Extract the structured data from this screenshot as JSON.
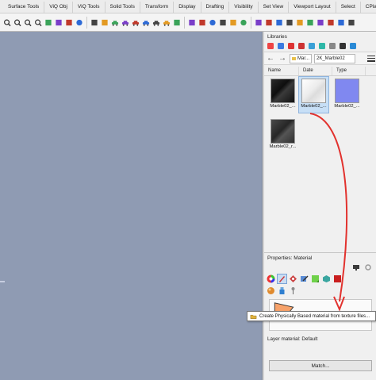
{
  "menu_tabs": [
    "Surface Tools",
    "ViQ Obj",
    "ViQ Tools",
    "Solid Tools",
    "Transform",
    "Display",
    "Drafting",
    "Visibility",
    "Set View",
    "Viewport Layout",
    "Select",
    "CPlane"
  ],
  "toolbar_icons": [
    "zoom-icon",
    "pan-icon",
    "zoom-window-icon",
    "zoom-selected-icon",
    "undo-view-icon",
    "rotate-view-icon",
    "view-icon",
    "sphere-icon",
    "wireframe-icon",
    "mug-icon",
    "car-icon",
    "car-icon",
    "car-icon",
    "car-icon",
    "car-icon",
    "car-icon",
    "shape-icon",
    "camera-icon",
    "desk-icon",
    "eye-icon",
    "light-icon",
    "light-icon",
    "bulb-icon",
    "save-icon",
    "shape-icon",
    "shape-icon",
    "shape-icon",
    "shape-icon",
    "shape-icon",
    "shape-icon",
    "shape-icon",
    "shape-icon",
    "shape-icon"
  ],
  "libraries": {
    "title": "Libraries",
    "icons": [
      "color-wheel-icon",
      "paint-icon",
      "tag-icon",
      "tag-icon",
      "image-icon",
      "cloud-icon",
      "layers-icon",
      "camera-icon",
      "globe-icon"
    ],
    "breadcrumb": [
      "Mar...",
      "2K_Marble02"
    ],
    "columns": [
      "Name",
      "Date",
      "Type"
    ],
    "items": [
      {
        "label": "Marble02_...",
        "swatch": "#1a1a1a"
      },
      {
        "label": "Marble02_...",
        "swatch": "#f2f2f2"
      },
      {
        "label": "Marble02_...",
        "swatch": "#8088f0"
      },
      {
        "label": "Marble02_r...",
        "swatch": "#3a3a3a"
      }
    ]
  },
  "properties": {
    "title": "Properties: Material",
    "layer_material_label": "Layer material:",
    "layer_material_value": "Default",
    "match_button": "Match..."
  },
  "tooltip": {
    "text": "Create Physically Based material from texture files..."
  },
  "colors": {
    "viewport": "#8f9bb3",
    "arrow": "#e2322e",
    "selection": "#c7dff6"
  }
}
